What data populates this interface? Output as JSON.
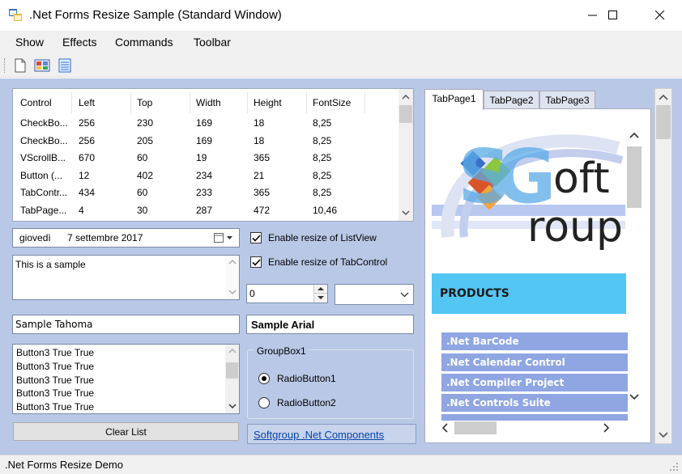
{
  "window": {
    "title": ".Net Forms Resize Sample (Standard Window)",
    "icon": "app-forms-icon"
  },
  "menu": {
    "items": [
      {
        "label": "Show"
      },
      {
        "label": "Effects"
      },
      {
        "label": "Commands"
      },
      {
        "label": "Toolbar"
      }
    ]
  },
  "toolbar": {
    "buttons": [
      {
        "icon": "new-document-icon"
      },
      {
        "icon": "image-gallery-icon"
      },
      {
        "icon": "spreadsheet-icon"
      }
    ]
  },
  "listview": {
    "columns": [
      "Control",
      "Left",
      "Top",
      "Width",
      "Height",
      "FontSize"
    ],
    "rows": [
      [
        "CheckBo...",
        "256",
        "230",
        "169",
        "18",
        "8,25"
      ],
      [
        "CheckBo...",
        "256",
        "205",
        "169",
        "18",
        "8,25"
      ],
      [
        "VScrollB...",
        "670",
        "60",
        "19",
        "365",
        "8,25"
      ],
      [
        "Button (...",
        "12",
        "402",
        "234",
        "21",
        "8,25"
      ],
      [
        "TabContr...",
        "434",
        "60",
        "233",
        "365",
        "8,25"
      ],
      [
        "TabPage...",
        "4",
        "30",
        "287",
        "472",
        "10,46"
      ]
    ]
  },
  "datepicker": {
    "day": "giovedì",
    "date": "7 settembre 2017"
  },
  "textarea": {
    "value": "This is a sample"
  },
  "checkboxes": [
    {
      "label": "Enable resize of ListView",
      "checked": true
    },
    {
      "label": "Enable resize of TabControl",
      "checked": true
    }
  ],
  "numeric": {
    "value": "0"
  },
  "combo": {
    "value": ""
  },
  "textbox_tahoma": {
    "value": "Sample Tahoma"
  },
  "textbox_arial": {
    "value": "Sample Arial"
  },
  "listbox": {
    "items": [
      "Button3 True True",
      "Button3 True True",
      "Button3 True True",
      "Button3 True True",
      "Button3 True True"
    ]
  },
  "groupbox": {
    "title": "GroupBox1",
    "radios": [
      {
        "label": "RadioButton1",
        "checked": true
      },
      {
        "label": "RadioButton2",
        "checked": false
      }
    ]
  },
  "clear_button": {
    "label": "Clear List"
  },
  "link": {
    "label": "Softgroup .Net Components"
  },
  "tabs": [
    {
      "label": "TabPage1",
      "active": true
    },
    {
      "label": "TabPage2",
      "active": false
    },
    {
      "label": "TabPage3",
      "active": false
    }
  ],
  "tabpage": {
    "logo_text_top": "oft",
    "logo_text_bottom": "roup",
    "logo_letters": "SG",
    "products_heading": "PRODUCTS",
    "products": [
      ".Net BarCode",
      ".Net Calendar Control",
      ".Net Compiler Project",
      ".Net Controls Suite"
    ]
  },
  "status": {
    "text": ".Net Forms Resize Demo"
  },
  "colors": {
    "client_bg": "#b9c8e6",
    "products_banner": "#54c6f4",
    "product_item": "#8fa6e2",
    "link": "#0645ad"
  }
}
